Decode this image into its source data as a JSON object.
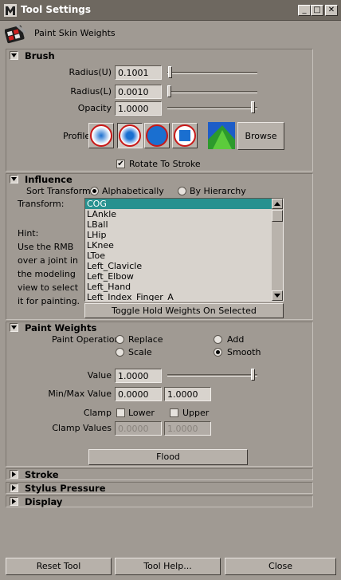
{
  "window": {
    "title": "Tool Settings"
  },
  "tool": {
    "name": "Paint Skin Weights"
  },
  "brush": {
    "header": "Brush",
    "radius_u": {
      "label": "Radius(U)",
      "value": "0.1001",
      "level": 0.02
    },
    "radius_l": {
      "label": "Radius(L)",
      "value": "0.0010",
      "level": 0.0
    },
    "opacity": {
      "label": "Opacity",
      "value": "1.0000",
      "level": 1.0
    },
    "profile_label": "Profile",
    "profile_icons": [
      "gaussian-brush-icon",
      "soft-brush-icon",
      "solid-round-brush-icon",
      "square-brush-icon",
      "image-brush-icon"
    ],
    "browse_label": "Browse",
    "rotate_label": "Rotate To Stroke",
    "rotate_checked": true
  },
  "influence": {
    "header": "Influence",
    "sort_label": "Sort Transforms",
    "sort_options": [
      "Alphabetically",
      "By Hierarchy"
    ],
    "sort_selected": "Alphabetically",
    "transform_label": "Transform:",
    "hint_lines": [
      "Hint:",
      "Use the RMB",
      "over a joint in",
      "the modeling",
      "view to select",
      "it for painting."
    ],
    "transforms": [
      "COG",
      "LAnkle",
      "LBall",
      "LHip",
      "LKnee",
      "LToe",
      "Left_Clavicle",
      "Left_Elbow",
      "Left_Hand",
      "Left_Index_Finger_A"
    ],
    "selected_transform": "COG",
    "toggle_label": "Toggle Hold Weights On Selected"
  },
  "paint_weights": {
    "header": "Paint Weights",
    "op_label": "Paint Operation",
    "ops": [
      "Replace",
      "Add",
      "Scale",
      "Smooth"
    ],
    "op_selected": "Smooth",
    "value_label": "Value",
    "value": "1.0000",
    "value_level": 1.0,
    "minmax_label": "Min/Max Value",
    "min": "0.0000",
    "max": "1.0000",
    "clamp_label": "Clamp",
    "clamp_lower": "Lower",
    "clamp_upper": "Upper",
    "clamp_values_label": "Clamp Values",
    "clamp_min": "0.0000",
    "clamp_max": "1.0000",
    "flood_label": "Flood"
  },
  "collapsed": {
    "stroke": "Stroke",
    "stylus": "Stylus Pressure",
    "display": "Display"
  },
  "footer": {
    "reset": "Reset Tool",
    "help": "Tool Help...",
    "close": "Close"
  }
}
